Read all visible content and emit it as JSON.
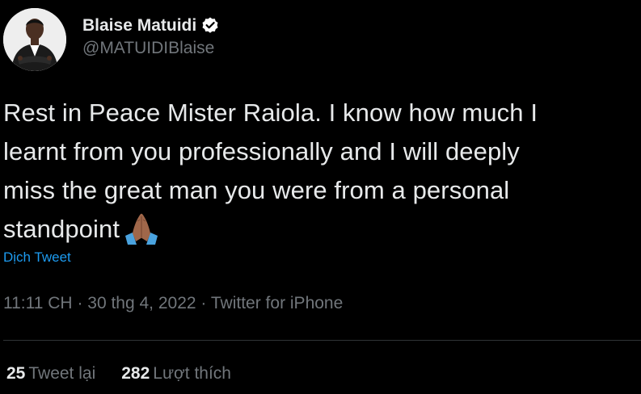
{
  "user": {
    "display_name": "Blaise Matuidi",
    "handle": "@MATUIDIBlaise",
    "verified": true,
    "verified_color": "#ffffff"
  },
  "tweet": {
    "lines": [
      "Rest in Peace Mister Raiola. I know how much I",
      "learnt from you professionally and I will deeply",
      "miss the great man you were from a personal",
      "standpoint"
    ],
    "emoji": "folded-hands-icon"
  },
  "translate_label": "Dịch Tweet",
  "meta": {
    "time": "11:11 CH",
    "separator": " · ",
    "date": "30 thg 4, 2022",
    "source": "Twitter for iPhone"
  },
  "stats": {
    "retweets": {
      "count": "25",
      "label": "Tweet lại"
    },
    "likes": {
      "count": "282",
      "label": "Lượt thích"
    }
  },
  "colors": {
    "background": "#000000",
    "text": "#e7e9ea",
    "secondary": "#71767b",
    "link": "#1d9bf0",
    "divider": "#2f3336"
  }
}
